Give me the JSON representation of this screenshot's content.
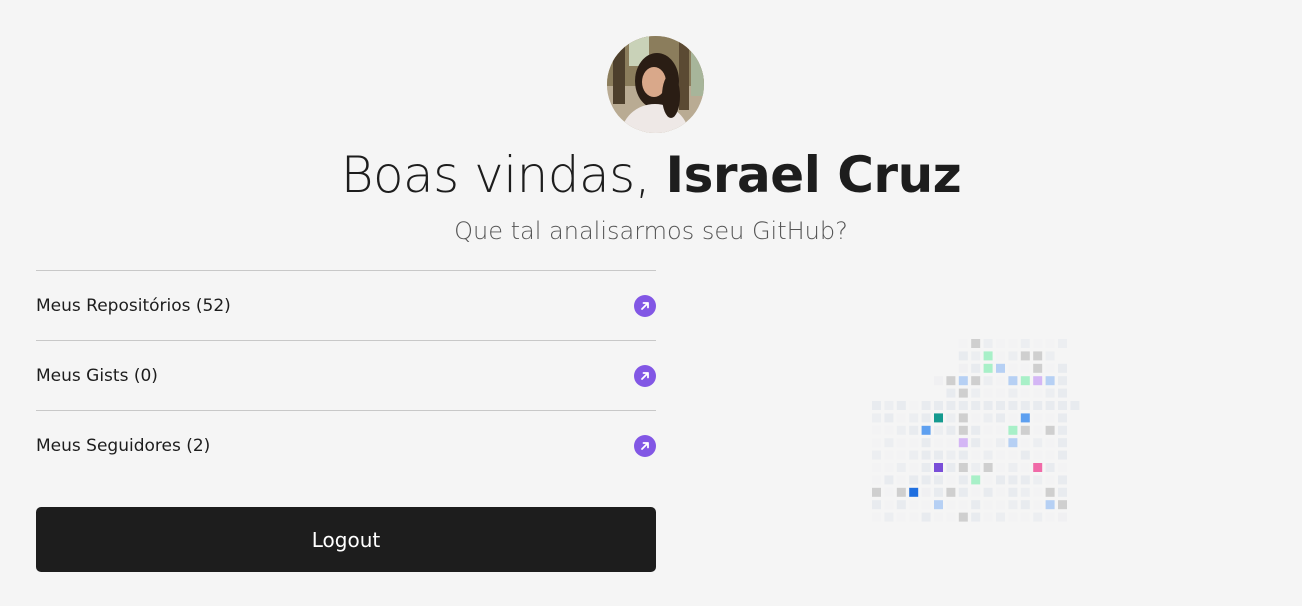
{
  "header": {
    "greeting": "Boas vindas,",
    "user_name": "Israel Cruz",
    "subtitle": "Que tal analisarmos seu GitHub?"
  },
  "menu": {
    "items": [
      {
        "label": "Meus Repositórios (52)",
        "icon": "arrow-up-right-icon"
      },
      {
        "label": "Meus Gists (0)",
        "icon": "arrow-up-right-icon"
      },
      {
        "label": "Meus Seguidores (2)",
        "icon": "arrow-up-right-icon"
      }
    ]
  },
  "actions": {
    "logout_label": "Logout"
  },
  "colors": {
    "background": "#f5f5f5",
    "accent": "#8257e5",
    "button": "#1d1d1d",
    "text": "#1d1d1d",
    "subtitle_text": "#555555",
    "divider": "#c8c8c8"
  }
}
